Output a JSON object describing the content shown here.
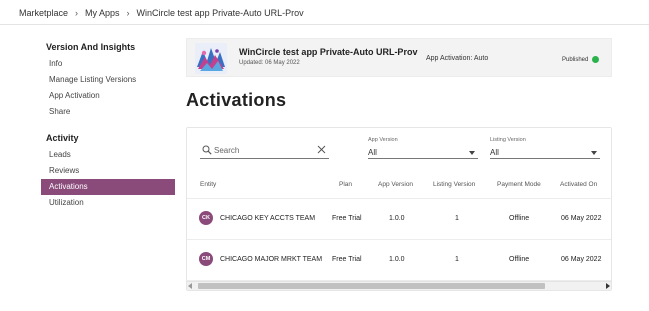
{
  "breadcrumb": {
    "items": [
      "Marketplace",
      "My Apps",
      "WinCircle test app Private-Auto URL-Prov"
    ],
    "separator": ">"
  },
  "sidebar": {
    "sections": [
      {
        "heading": "Version And Insights",
        "items": [
          "Info",
          "Manage Listing Versions",
          "App Activation",
          "Share"
        ]
      },
      {
        "heading": "Activity",
        "items": [
          "Leads",
          "Reviews",
          "Activations",
          "Utilization"
        ]
      }
    ],
    "active_item": "Activations",
    "accent_color": "#8a4a7a"
  },
  "app_card": {
    "title": "WinCircle test app Private-Auto URL-Prov",
    "updated": "Updated: 06 May 2022",
    "activation": "App Activation: Auto",
    "status": "Published",
    "status_color": "#2bb24c",
    "logo_icon": "app-logo-icon"
  },
  "page_title": "Activations",
  "filters": {
    "search_placeholder": "Search",
    "app_version": {
      "label": "App Version",
      "value": "All"
    },
    "listing_version": {
      "label": "Listing Version",
      "value": "All"
    }
  },
  "table": {
    "columns": [
      "Entity",
      "Plan",
      "App Version",
      "Listing Version",
      "Payment Mode",
      "Activated On"
    ],
    "rows": [
      {
        "initials": "CK",
        "entity": "CHICAGO KEY ACCTS TEAM",
        "plan": "Free Trial",
        "app_version": "1.0.0",
        "listing_version": "1",
        "payment_mode": "Offline",
        "activated_on": "06 May 2022"
      },
      {
        "initials": "CM",
        "entity": "CHICAGO MAJOR MRKT TEAM",
        "plan": "Free Trial",
        "app_version": "1.0.0",
        "listing_version": "1",
        "payment_mode": "Offline",
        "activated_on": "06 May 2022"
      }
    ]
  }
}
